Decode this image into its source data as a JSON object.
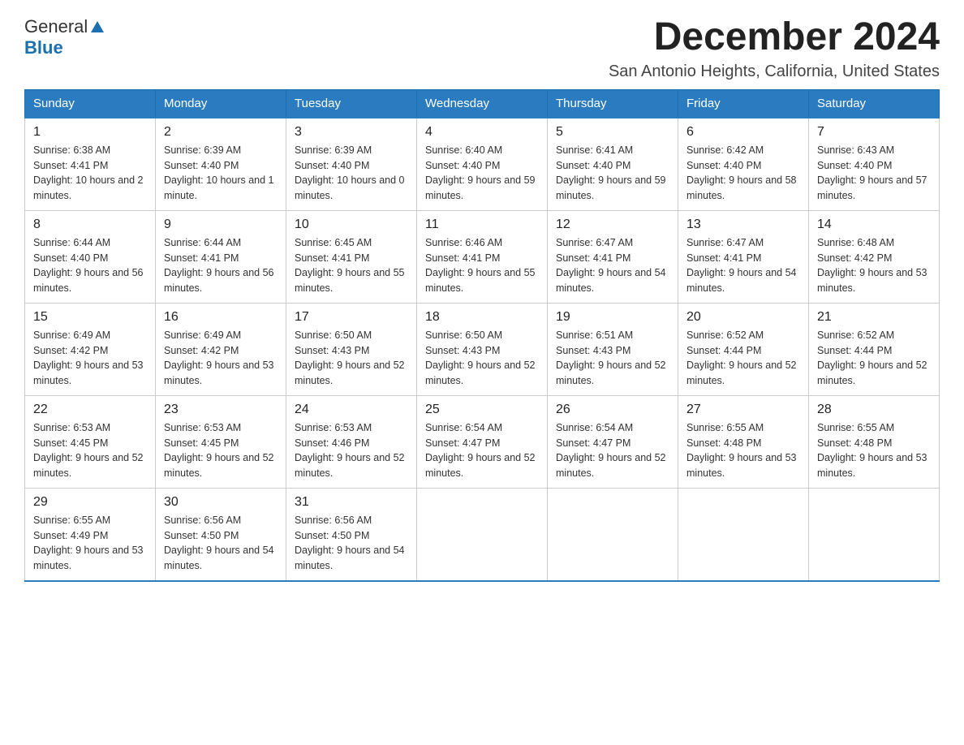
{
  "header": {
    "logo_general": "General",
    "logo_blue": "Blue",
    "month_title": "December 2024",
    "location": "San Antonio Heights, California, United States"
  },
  "weekdays": [
    "Sunday",
    "Monday",
    "Tuesday",
    "Wednesday",
    "Thursday",
    "Friday",
    "Saturday"
  ],
  "weeks": [
    [
      {
        "day": "1",
        "sunrise": "Sunrise: 6:38 AM",
        "sunset": "Sunset: 4:41 PM",
        "daylight": "Daylight: 10 hours and 2 minutes."
      },
      {
        "day": "2",
        "sunrise": "Sunrise: 6:39 AM",
        "sunset": "Sunset: 4:40 PM",
        "daylight": "Daylight: 10 hours and 1 minute."
      },
      {
        "day": "3",
        "sunrise": "Sunrise: 6:39 AM",
        "sunset": "Sunset: 4:40 PM",
        "daylight": "Daylight: 10 hours and 0 minutes."
      },
      {
        "day": "4",
        "sunrise": "Sunrise: 6:40 AM",
        "sunset": "Sunset: 4:40 PM",
        "daylight": "Daylight: 9 hours and 59 minutes."
      },
      {
        "day": "5",
        "sunrise": "Sunrise: 6:41 AM",
        "sunset": "Sunset: 4:40 PM",
        "daylight": "Daylight: 9 hours and 59 minutes."
      },
      {
        "day": "6",
        "sunrise": "Sunrise: 6:42 AM",
        "sunset": "Sunset: 4:40 PM",
        "daylight": "Daylight: 9 hours and 58 minutes."
      },
      {
        "day": "7",
        "sunrise": "Sunrise: 6:43 AM",
        "sunset": "Sunset: 4:40 PM",
        "daylight": "Daylight: 9 hours and 57 minutes."
      }
    ],
    [
      {
        "day": "8",
        "sunrise": "Sunrise: 6:44 AM",
        "sunset": "Sunset: 4:40 PM",
        "daylight": "Daylight: 9 hours and 56 minutes."
      },
      {
        "day": "9",
        "sunrise": "Sunrise: 6:44 AM",
        "sunset": "Sunset: 4:41 PM",
        "daylight": "Daylight: 9 hours and 56 minutes."
      },
      {
        "day": "10",
        "sunrise": "Sunrise: 6:45 AM",
        "sunset": "Sunset: 4:41 PM",
        "daylight": "Daylight: 9 hours and 55 minutes."
      },
      {
        "day": "11",
        "sunrise": "Sunrise: 6:46 AM",
        "sunset": "Sunset: 4:41 PM",
        "daylight": "Daylight: 9 hours and 55 minutes."
      },
      {
        "day": "12",
        "sunrise": "Sunrise: 6:47 AM",
        "sunset": "Sunset: 4:41 PM",
        "daylight": "Daylight: 9 hours and 54 minutes."
      },
      {
        "day": "13",
        "sunrise": "Sunrise: 6:47 AM",
        "sunset": "Sunset: 4:41 PM",
        "daylight": "Daylight: 9 hours and 54 minutes."
      },
      {
        "day": "14",
        "sunrise": "Sunrise: 6:48 AM",
        "sunset": "Sunset: 4:42 PM",
        "daylight": "Daylight: 9 hours and 53 minutes."
      }
    ],
    [
      {
        "day": "15",
        "sunrise": "Sunrise: 6:49 AM",
        "sunset": "Sunset: 4:42 PM",
        "daylight": "Daylight: 9 hours and 53 minutes."
      },
      {
        "day": "16",
        "sunrise": "Sunrise: 6:49 AM",
        "sunset": "Sunset: 4:42 PM",
        "daylight": "Daylight: 9 hours and 53 minutes."
      },
      {
        "day": "17",
        "sunrise": "Sunrise: 6:50 AM",
        "sunset": "Sunset: 4:43 PM",
        "daylight": "Daylight: 9 hours and 52 minutes."
      },
      {
        "day": "18",
        "sunrise": "Sunrise: 6:50 AM",
        "sunset": "Sunset: 4:43 PM",
        "daylight": "Daylight: 9 hours and 52 minutes."
      },
      {
        "day": "19",
        "sunrise": "Sunrise: 6:51 AM",
        "sunset": "Sunset: 4:43 PM",
        "daylight": "Daylight: 9 hours and 52 minutes."
      },
      {
        "day": "20",
        "sunrise": "Sunrise: 6:52 AM",
        "sunset": "Sunset: 4:44 PM",
        "daylight": "Daylight: 9 hours and 52 minutes."
      },
      {
        "day": "21",
        "sunrise": "Sunrise: 6:52 AM",
        "sunset": "Sunset: 4:44 PM",
        "daylight": "Daylight: 9 hours and 52 minutes."
      }
    ],
    [
      {
        "day": "22",
        "sunrise": "Sunrise: 6:53 AM",
        "sunset": "Sunset: 4:45 PM",
        "daylight": "Daylight: 9 hours and 52 minutes."
      },
      {
        "day": "23",
        "sunrise": "Sunrise: 6:53 AM",
        "sunset": "Sunset: 4:45 PM",
        "daylight": "Daylight: 9 hours and 52 minutes."
      },
      {
        "day": "24",
        "sunrise": "Sunrise: 6:53 AM",
        "sunset": "Sunset: 4:46 PM",
        "daylight": "Daylight: 9 hours and 52 minutes."
      },
      {
        "day": "25",
        "sunrise": "Sunrise: 6:54 AM",
        "sunset": "Sunset: 4:47 PM",
        "daylight": "Daylight: 9 hours and 52 minutes."
      },
      {
        "day": "26",
        "sunrise": "Sunrise: 6:54 AM",
        "sunset": "Sunset: 4:47 PM",
        "daylight": "Daylight: 9 hours and 52 minutes."
      },
      {
        "day": "27",
        "sunrise": "Sunrise: 6:55 AM",
        "sunset": "Sunset: 4:48 PM",
        "daylight": "Daylight: 9 hours and 53 minutes."
      },
      {
        "day": "28",
        "sunrise": "Sunrise: 6:55 AM",
        "sunset": "Sunset: 4:48 PM",
        "daylight": "Daylight: 9 hours and 53 minutes."
      }
    ],
    [
      {
        "day": "29",
        "sunrise": "Sunrise: 6:55 AM",
        "sunset": "Sunset: 4:49 PM",
        "daylight": "Daylight: 9 hours and 53 minutes."
      },
      {
        "day": "30",
        "sunrise": "Sunrise: 6:56 AM",
        "sunset": "Sunset: 4:50 PM",
        "daylight": "Daylight: 9 hours and 54 minutes."
      },
      {
        "day": "31",
        "sunrise": "Sunrise: 6:56 AM",
        "sunset": "Sunset: 4:50 PM",
        "daylight": "Daylight: 9 hours and 54 minutes."
      },
      null,
      null,
      null,
      null
    ]
  ]
}
